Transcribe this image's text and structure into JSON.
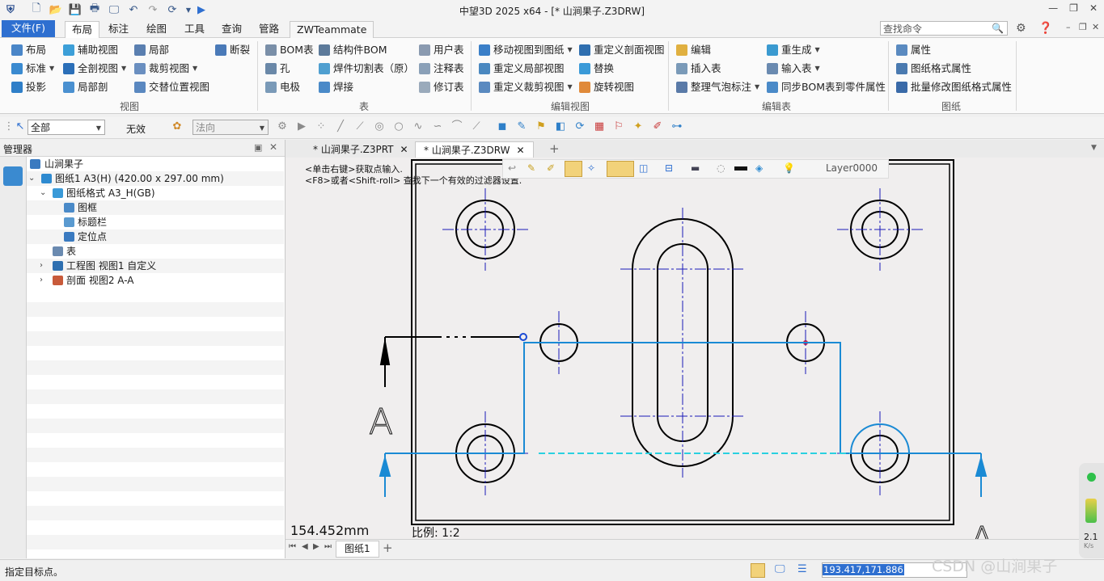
{
  "titlebar": {
    "title": "中望3D 2025 x64 - [* 山涧果子.Z3DRW]",
    "quick_icons": [
      "logo-icon",
      "new-icon",
      "open-icon",
      "save-icon",
      "print-icon",
      "print-preview-icon",
      "undo-icon",
      "redo-icon",
      "regen-icon",
      "dropdown-icon",
      "run-icon"
    ]
  },
  "ribbon_tabs": {
    "file": "文件(F)",
    "tabs": [
      "布局",
      "标注",
      "绘图",
      "工具",
      "查询",
      "管路",
      "ZWTeammate"
    ],
    "active": "布局",
    "search_placeholder": "查找命令"
  },
  "ribbon": {
    "view": {
      "label": "视图",
      "items": [
        "布局",
        "辅助视图",
        "局部",
        "断裂",
        "标准",
        "全剖视图",
        "裁剪视图",
        "投影",
        "局部剖",
        "交替位置视图"
      ]
    },
    "table": {
      "label": "表",
      "items": [
        "BOM表",
        "结构件BOM",
        "用户表",
        "孔",
        "焊件切割表（原）",
        "注释表",
        "电极",
        "焊接",
        "修订表"
      ]
    },
    "edit_view": {
      "label": "编辑视图",
      "items": [
        "移动视图到图纸",
        "重定义剖面视图",
        "重定义局部视图",
        "替换",
        "重定义裁剪视图",
        "旋转视图"
      ]
    },
    "edit_table": {
      "label": "编辑表",
      "items": [
        "编辑",
        "重生成",
        "插入表",
        "输入表",
        "整理气泡标注",
        "同步BOM表到零件属性"
      ]
    },
    "sheet": {
      "label": "图纸",
      "items": [
        "属性",
        "图纸格式属性",
        "批量修改图纸格式属性"
      ]
    }
  },
  "toolbar2": {
    "filter": "全部",
    "invalid": "无效",
    "direction": "法向"
  },
  "manager": {
    "title": "管理器",
    "tree": [
      {
        "label": "山涧果子",
        "indent": 0,
        "chev": ""
      },
      {
        "label": "图纸1 A3(H) (420.00 x 297.00 mm)",
        "indent": 1,
        "chev": "v"
      },
      {
        "label": "图纸格式 A3_H(GB)",
        "indent": 2,
        "chev": "v"
      },
      {
        "label": "图框",
        "indent": 3,
        "chev": ""
      },
      {
        "label": "标题栏",
        "indent": 3,
        "chev": ""
      },
      {
        "label": "定位点",
        "indent": 3,
        "chev": ""
      },
      {
        "label": "表",
        "indent": 2,
        "chev": ""
      },
      {
        "label": "工程图 视图1 自定义",
        "indent": 1,
        "chev": ">"
      },
      {
        "label": "剖面 视图2 A-A",
        "indent": 1,
        "chev": ">"
      }
    ]
  },
  "doc_tabs": [
    "* 山涧果子.Z3PRT",
    "* 山涧果子.Z3DRW"
  ],
  "canvas": {
    "hint1": "<单击右键>获取点输入.",
    "hint2": "<F8>或者<Shift-roll> 查找下一个有效的过滤器设置.",
    "layer": "Layer0000",
    "distance": "154.452mm",
    "scale": "比例:   1:2",
    "section_label": "A"
  },
  "sheet_tab": "图纸1",
  "status": {
    "prompt": "指定目标点。",
    "coords": "193.417,171.886"
  },
  "perf": {
    "value": "2.1",
    "unit": "K/s"
  },
  "watermark": "CSDN @山涧果子",
  "colors": {
    "accent": "#2e6fd0",
    "section_line": "#1a8ad4",
    "centerline": "#1a1ab8"
  }
}
